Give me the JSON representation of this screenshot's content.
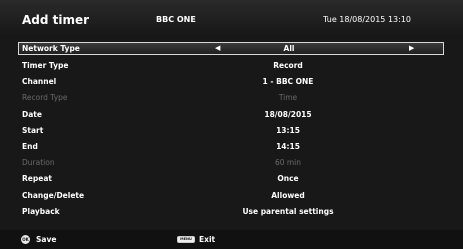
{
  "header": {
    "title": "Add timer",
    "channel": "BBC ONE",
    "datetime": "Tue 18/08/2015 13:10"
  },
  "rows": [
    {
      "label": "Network Type",
      "value": "All",
      "selected": true,
      "arrows": true
    },
    {
      "label": "Timer Type",
      "value": "Record"
    },
    {
      "label": "Channel",
      "value": "1 - BBC ONE"
    },
    {
      "label": "Record Type",
      "value": "Time",
      "disabled": true
    },
    {
      "label": "Date",
      "value": "18/08/2015"
    },
    {
      "label": "Start",
      "value": "13:15"
    },
    {
      "label": "End",
      "value": "14:15"
    },
    {
      "label": "Duration",
      "value": "60 min",
      "disabled": true
    },
    {
      "label": "Repeat",
      "value": "Once"
    },
    {
      "label": "Change/Delete",
      "value": "Allowed"
    },
    {
      "label": "Playback",
      "value": "Use parental settings"
    }
  ],
  "footer": {
    "ok_icon_text": "OK",
    "save_label": "Save",
    "menu_icon_text": "MENU",
    "exit_label": "Exit"
  },
  "icons": {
    "left": "◀",
    "right": "▶"
  }
}
